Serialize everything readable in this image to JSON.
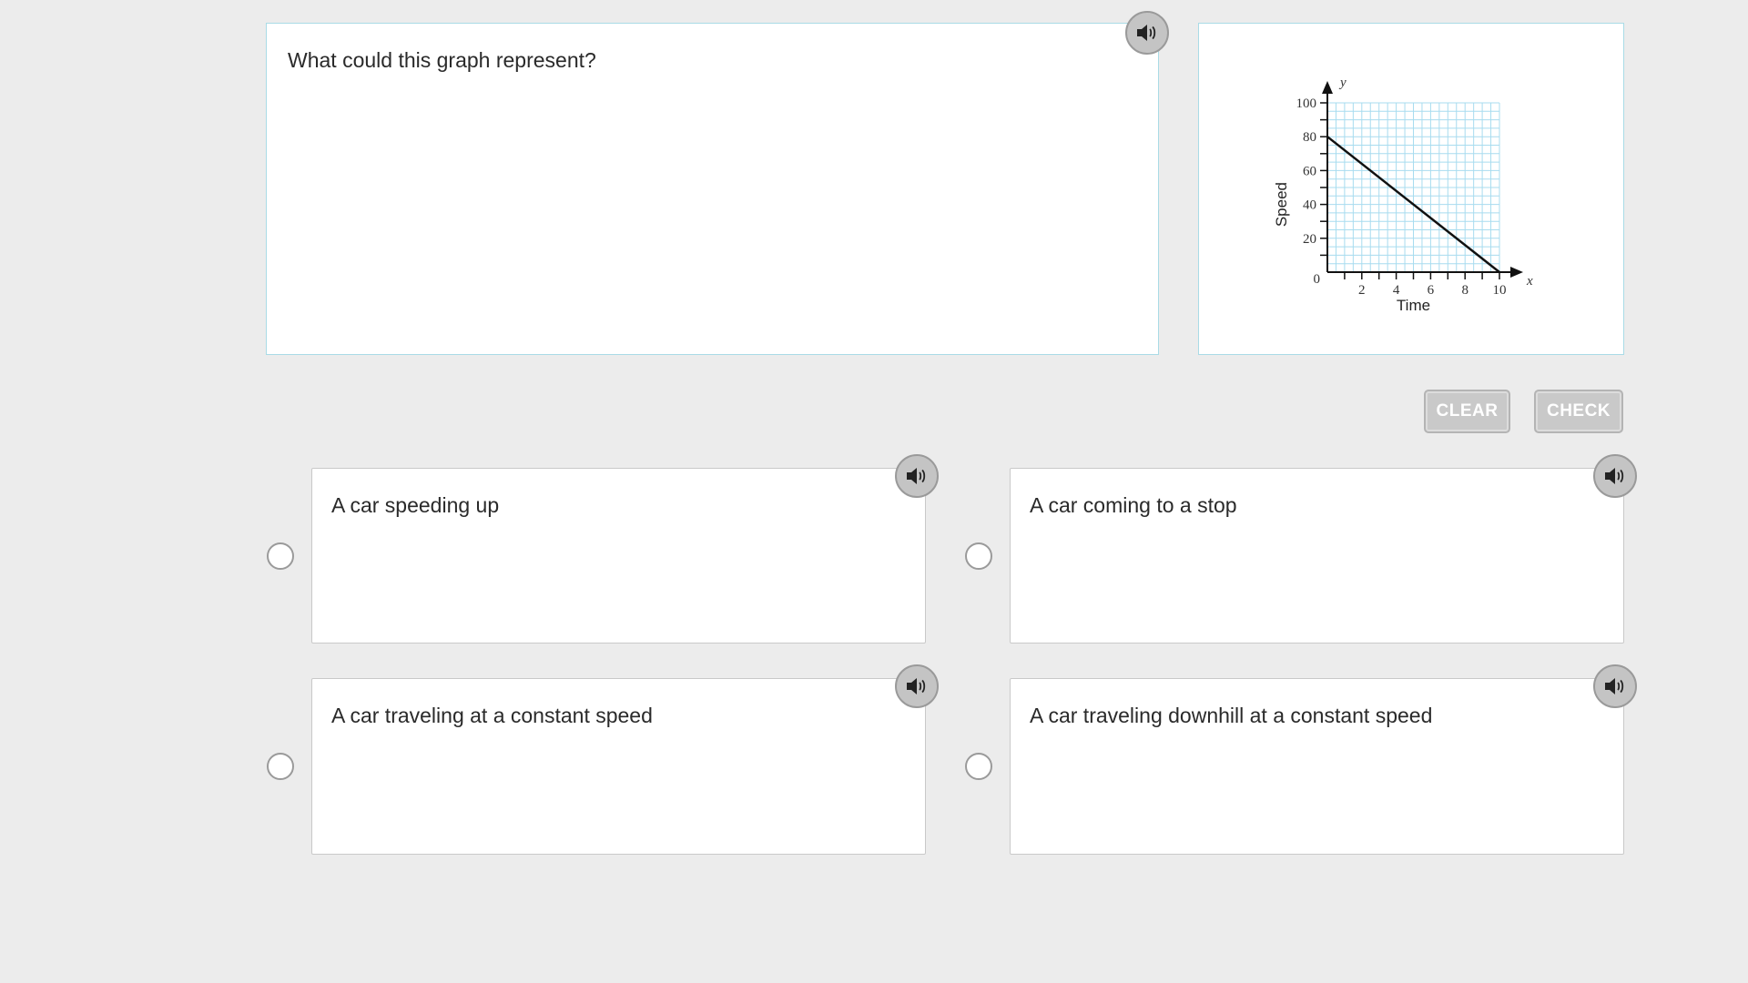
{
  "question": {
    "text": "What could this graph represent?",
    "audio_icon": "speaker-icon"
  },
  "graph": {
    "ylabel": "Speed",
    "xlabel": "Time",
    "y_axis_letter": "y",
    "x_axis_letter": "x",
    "origin_label": "0",
    "y_ticks": [
      "100",
      "80",
      "60",
      "40",
      "20"
    ],
    "x_ticks": [
      "2",
      "4",
      "6",
      "8",
      "10"
    ],
    "grid_color": "#a8dcef"
  },
  "chart_data": {
    "type": "line",
    "title": "",
    "xlabel": "Time",
    "ylabel": "Speed",
    "xlim": [
      0,
      10
    ],
    "ylim": [
      0,
      100
    ],
    "x_ticks": [
      2,
      4,
      6,
      8,
      10
    ],
    "y_ticks": [
      20,
      40,
      60,
      80,
      100
    ],
    "grid": true,
    "series": [
      {
        "x": [
          0,
          10
        ],
        "y": [
          80,
          0
        ]
      }
    ]
  },
  "buttons": {
    "clear_label": "CLEAR",
    "check_label": "CHECK"
  },
  "choices": [
    {
      "text": "A car speeding up"
    },
    {
      "text": "A car coming to a stop"
    },
    {
      "text": "A car traveling at a constant speed"
    },
    {
      "text": "A car traveling downhill at a constant speed"
    }
  ],
  "colors": {
    "background": "#ececec",
    "panel_border": "#a9dbe6",
    "button_disabled": "#c9c9c9"
  }
}
